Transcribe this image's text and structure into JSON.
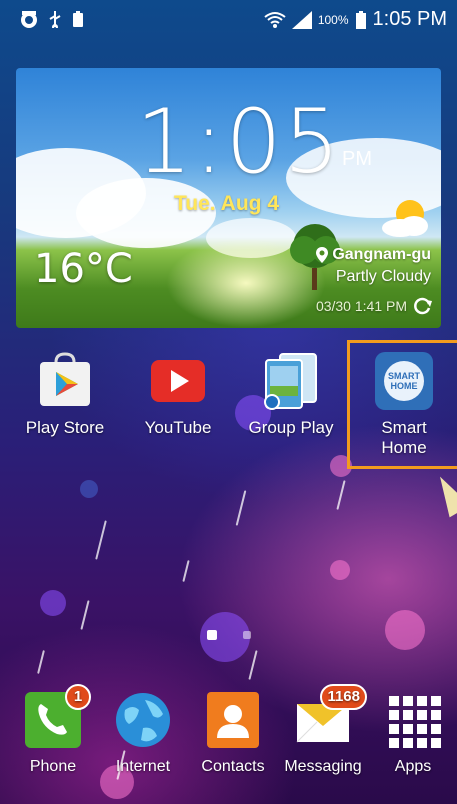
{
  "status_bar": {
    "battery_percent": "100%",
    "time": "1:05 PM"
  },
  "widget": {
    "time": "1:05",
    "ampm": "PM",
    "date": "Tue. Aug 4",
    "temperature": "16°C",
    "location": "Gangnam-gu",
    "condition": "Partly Cloudy",
    "updated": "03/30 1:41 PM"
  },
  "home_apps": [
    {
      "label": "Play Store"
    },
    {
      "label": "YouTube"
    },
    {
      "label": "Group Play"
    },
    {
      "label": "Smart\nHome",
      "icon_text": "SMART HOME"
    }
  ],
  "page_indicator": {
    "pages": 2,
    "current": 1
  },
  "dock": [
    {
      "label": "Phone",
      "badge": "1"
    },
    {
      "label": "Internet"
    },
    {
      "label": "Contacts"
    },
    {
      "label": "Messaging",
      "badge": "1168"
    },
    {
      "label": "Apps"
    }
  ],
  "colors": {
    "highlight": "#f39c1e",
    "badge": "#e04a1a",
    "date": "#ffe65a"
  }
}
